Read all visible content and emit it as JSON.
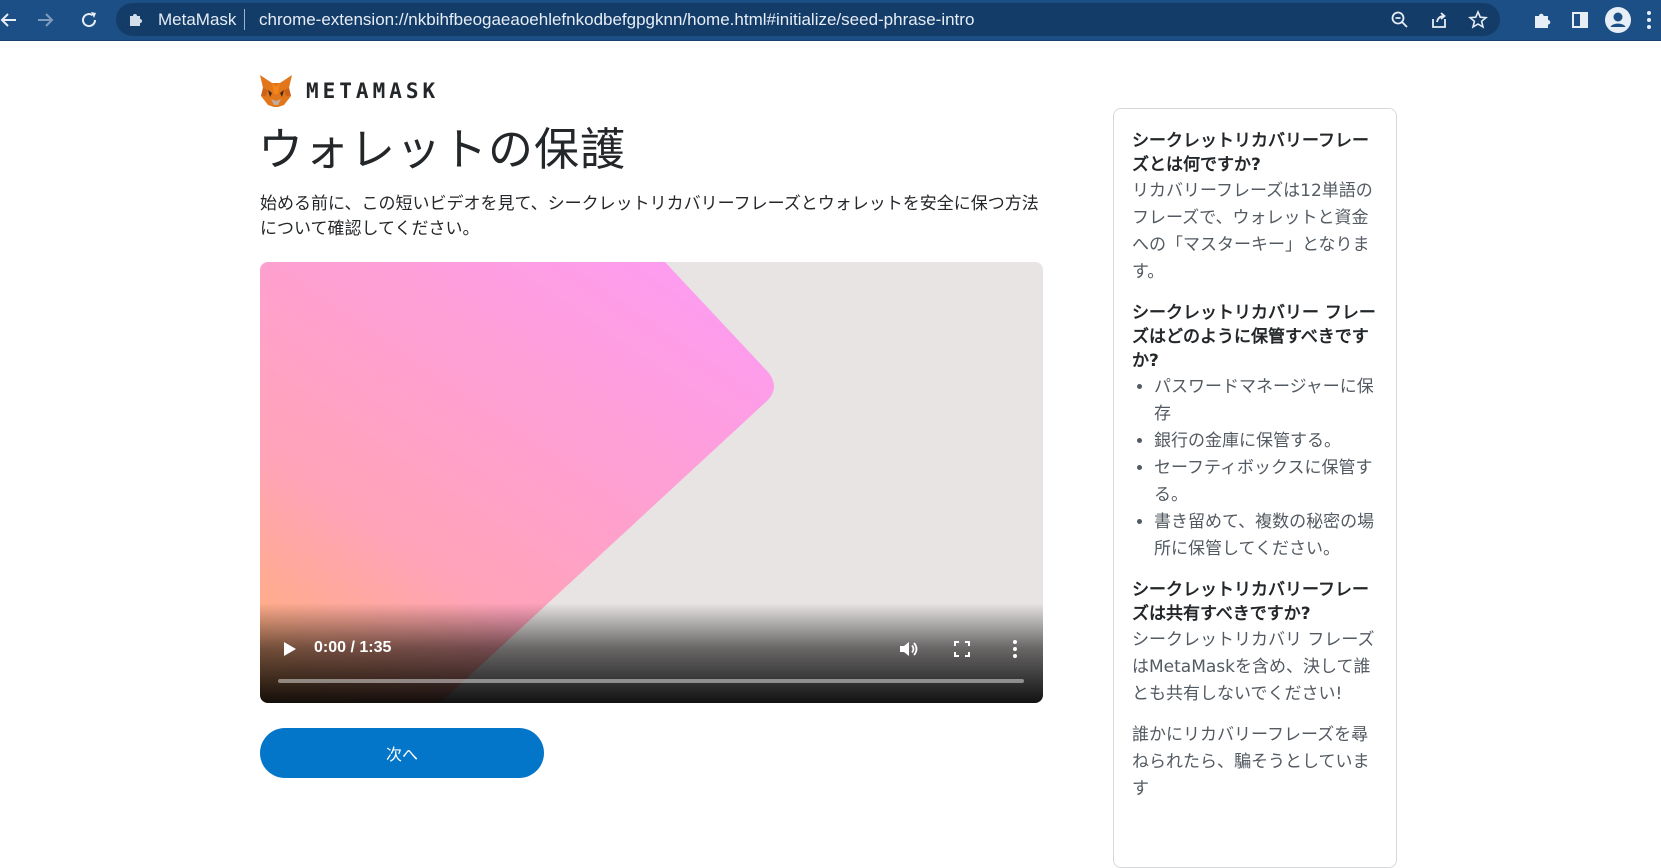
{
  "browser": {
    "site_name": "MetaMask",
    "url": "chrome-extension://nkbihfbeogaeaoehlefnkodbefgpgknn/home.html#initialize/seed-phrase-intro"
  },
  "brand": {
    "wordmark": "METAMASK"
  },
  "main": {
    "title": "ウォレットの保護",
    "intro": "始める前に、この短いビデオを見て、シークレットリカバリーフレーズとウォレットを安全に保つ方法について確認してください。",
    "video": {
      "time": "0:00 / 1:35",
      "progress": 0
    },
    "next_label": "次へ"
  },
  "sidebar": {
    "q1_title": "シークレットリカバリーフレーズとは何ですか?",
    "q1_body": "リカバリーフレーズは12単語のフレーズで、ウォレットと資金への「マスターキー」となります。",
    "q2_title": "シークレットリカバリー フレーズはどのように保管すべきですか?",
    "q2_items": [
      "パスワードマネージャーに保存",
      "銀行の金庫に保管する。",
      "セーフティボックスに保管する。",
      "書き留めて、複数の秘密の場所に保管してください。"
    ],
    "q3_title": "シークレットリカバリーフレーズは共有すべきですか?",
    "q3_body": "シークレットリカバリ フレーズはMetaMaskを含め、決して誰とも共有しないでください!",
    "q3_body2": "誰かにリカバリーフレーズを尋ねられたら、騙そうとしています"
  },
  "colors": {
    "toolbar": "#1c4f86",
    "primary_button": "#0376c9",
    "video_bg": "#e7e4e3"
  },
  "icons": {
    "back": "back-arrow-icon",
    "forward": "forward-arrow-icon",
    "reload": "reload-icon",
    "zoom": "zoom-icon",
    "share": "share-icon",
    "bookmark": "star-icon",
    "extensions": "puzzle-icon",
    "side_panel": "side-panel-icon",
    "profile": "profile-icon",
    "menu": "kebab-menu-icon"
  }
}
